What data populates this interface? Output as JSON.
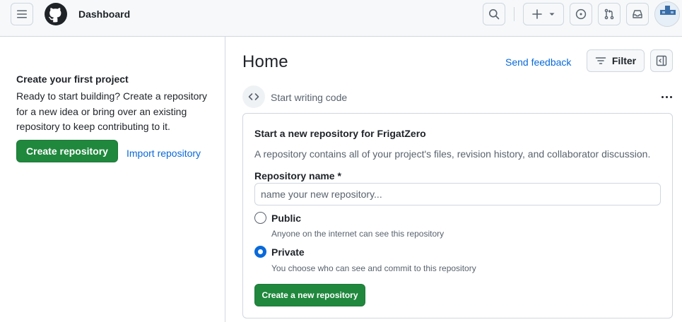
{
  "header": {
    "context": "Dashboard",
    "icons": {
      "menu": "hamburger-icon",
      "logo": "github-logo",
      "search": "search-icon",
      "create": "plus-icon",
      "create_caret": "triangle-down-icon",
      "issues": "issue-opened-icon",
      "pulls": "git-pull-request-icon",
      "inbox": "inbox-icon",
      "avatar": "user-avatar"
    }
  },
  "left_panel": {
    "title": "Create your first project",
    "description": "Ready to start building? Create a repository for a new idea or bring over an existing repository to keep contributing to it.",
    "create_button": "Create repository",
    "import_link": "Import repository"
  },
  "main": {
    "title": "Home",
    "feedback_link": "Send feedback",
    "filter_button": "Filter",
    "section_label": "Start writing code",
    "card": {
      "title": "Start a new repository for FrigatZero",
      "description": "A repository contains all of your project's files, revision history, and collaborator discussion.",
      "name_label": "Repository name *",
      "name_placeholder": "name your new repository...",
      "name_value": "",
      "visibility_options": [
        {
          "label": "Public",
          "description": "Anyone on the internet can see this repository",
          "selected": false
        },
        {
          "label": "Private",
          "description": "You choose who can see and commit to this repository",
          "selected": true
        }
      ],
      "submit_button": "Create a new repository"
    }
  },
  "colors": {
    "primary_green": "#1f883d",
    "link_blue": "#0969da",
    "header_bg": "#f6f8fa",
    "border": "#d0d7de",
    "muted_text": "#59636e"
  }
}
